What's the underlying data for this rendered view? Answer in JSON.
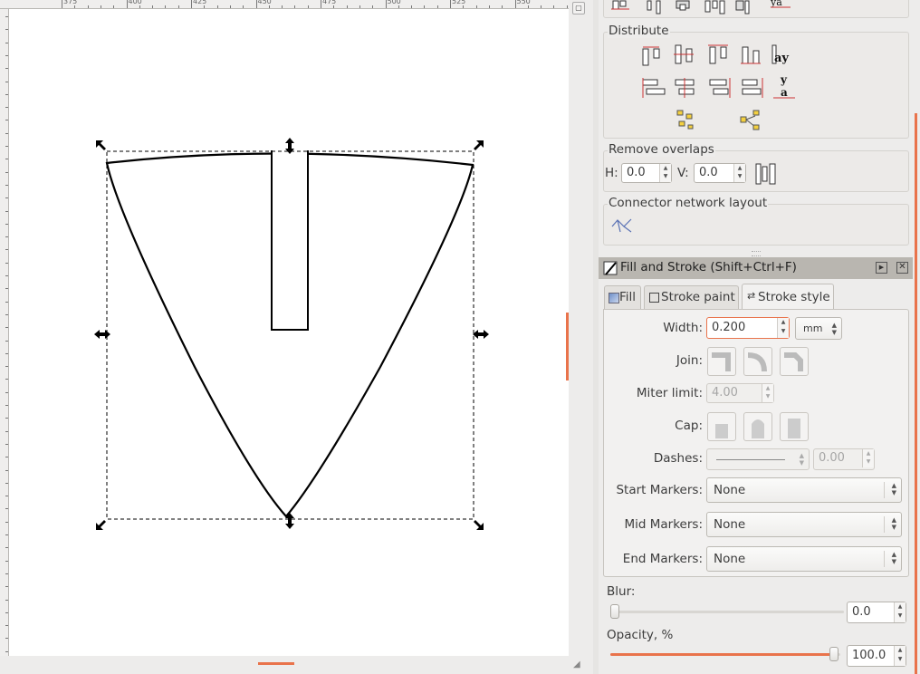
{
  "ruler": {
    "labels": [
      "375",
      "400",
      "425",
      "450",
      "475",
      "500",
      "525",
      "550"
    ]
  },
  "align_panel": {
    "distribute_label": "Distribute",
    "remove_overlaps_label": "Remove overlaps",
    "h_label": "H:",
    "h_value": "0.0",
    "v_label": "V:",
    "v_value": "0.0",
    "connector_label": "Connector network layout"
  },
  "fill_stroke": {
    "title": "Fill and Stroke (Shift+Ctrl+F)",
    "tabs": {
      "fill": "Fill",
      "stroke_paint": "Stroke paint",
      "stroke_style": "Stroke style"
    },
    "width_label": "Width:",
    "width_value": "0.200",
    "unit": "mm",
    "join_label": "Join:",
    "miter_label": "Miter limit:",
    "miter_value": "4.00",
    "cap_label": "Cap:",
    "dashes_label": "Dashes:",
    "dash_offset": "0.00",
    "start_markers_label": "Start Markers:",
    "start_markers_value": "None",
    "mid_markers_label": "Mid Markers:",
    "mid_markers_value": "None",
    "end_markers_label": "End Markers:",
    "end_markers_value": "None",
    "blur_label": "Blur:",
    "blur_value": "0.0",
    "opacity_label": "Opacity, %",
    "opacity_value": "100.0",
    "opacity_level": 1.0,
    "blur_level": 0.0
  },
  "colors": {
    "accent": "#e9734b",
    "header": "#b9b6b0"
  },
  "icons": [
    "align-icon",
    "distribute-icon",
    "remove-overlaps-icon",
    "connector-layout-icon",
    "fill-stroke-icon",
    "close-icon",
    "detach-icon"
  ]
}
